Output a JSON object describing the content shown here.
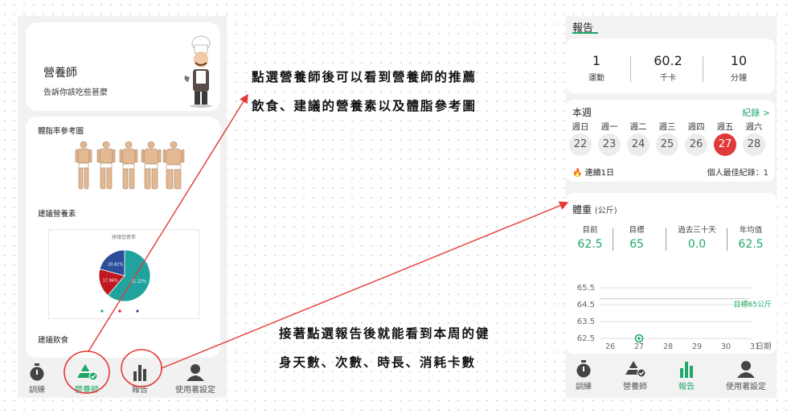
{
  "left_phone": {
    "nutritionist": {
      "title": "營養師",
      "subtitle": "告訴你該吃些甚麼"
    },
    "sections": {
      "bodyfat_chart_title": "體脂率參考圖",
      "nutrients_title": "建議營養素",
      "diet_title": "建議飲食"
    },
    "pie": {
      "title": "建議營養素",
      "slices": [
        {
          "label": "61.22%",
          "value": 61.22,
          "color": "#20a39e"
        },
        {
          "label": "17.96%",
          "value": 17.96,
          "color": "#c0181f"
        },
        {
          "label": "20.82%",
          "value": 20.82,
          "color": "#2b4d9a"
        }
      ]
    },
    "nav": [
      {
        "label": "訓練",
        "icon": "stopwatch-icon",
        "active": false
      },
      {
        "label": "營養師",
        "icon": "nutrition-icon",
        "active": true
      },
      {
        "label": "報告",
        "icon": "bar-chart-icon",
        "active": false
      },
      {
        "label": "使用著設定",
        "icon": "user-icon",
        "active": false
      }
    ]
  },
  "annotations": {
    "top": [
      "點選營養師後可以看到營養師的推薦",
      "飲食、建議的營養素以及體脂參考圖"
    ],
    "bottom": [
      "接著點選報告後就能看到本周的健",
      "身天數、次數、時長、消耗卡數"
    ]
  },
  "right_phone": {
    "header": "報告",
    "stats": [
      {
        "value": "1",
        "label": "運動"
      },
      {
        "value": "60.2",
        "label": "千卡"
      },
      {
        "value": "10",
        "label": "分鐘"
      }
    ],
    "week": {
      "title": "本週",
      "record_link": "紀錄 >",
      "days": [
        "週日",
        "週一",
        "週二",
        "週三",
        "週四",
        "週五",
        "週六"
      ],
      "dates": [
        "22",
        "23",
        "24",
        "25",
        "26",
        "27",
        "28"
      ],
      "today_index": 5,
      "streak": "連續1日",
      "best": "個人最佳紀錄：1"
    },
    "weight": {
      "title": "體重",
      "unit": "(公斤)",
      "stats": [
        {
          "label": "目前",
          "value": "62.5"
        },
        {
          "label": "目標",
          "value": "65"
        },
        {
          "label": "過去三十天",
          "value": "0.0"
        },
        {
          "label": "年均值",
          "value": "62.5"
        }
      ],
      "goal_label": "目標65公斤",
      "x_unit": "日期"
    },
    "nav": [
      {
        "label": "訓練",
        "icon": "stopwatch-icon",
        "active": false
      },
      {
        "label": "營養師",
        "icon": "nutrition-icon",
        "active": false
      },
      {
        "label": "報告",
        "icon": "bar-chart-icon",
        "active": true
      },
      {
        "label": "使用著設定",
        "icon": "user-icon",
        "active": false
      }
    ]
  },
  "chart_data": {
    "type": "line",
    "x": [
      26,
      27,
      28,
      29,
      30,
      31
    ],
    "series": [
      {
        "values": [
          null,
          62.5,
          null,
          null,
          null,
          null
        ]
      }
    ],
    "goal": 65,
    "ylim": [
      62.5,
      65.5
    ],
    "yticks": [
      62.5,
      63.5,
      64.5,
      65.5
    ],
    "xlabel": "日期",
    "ylabel": ""
  }
}
